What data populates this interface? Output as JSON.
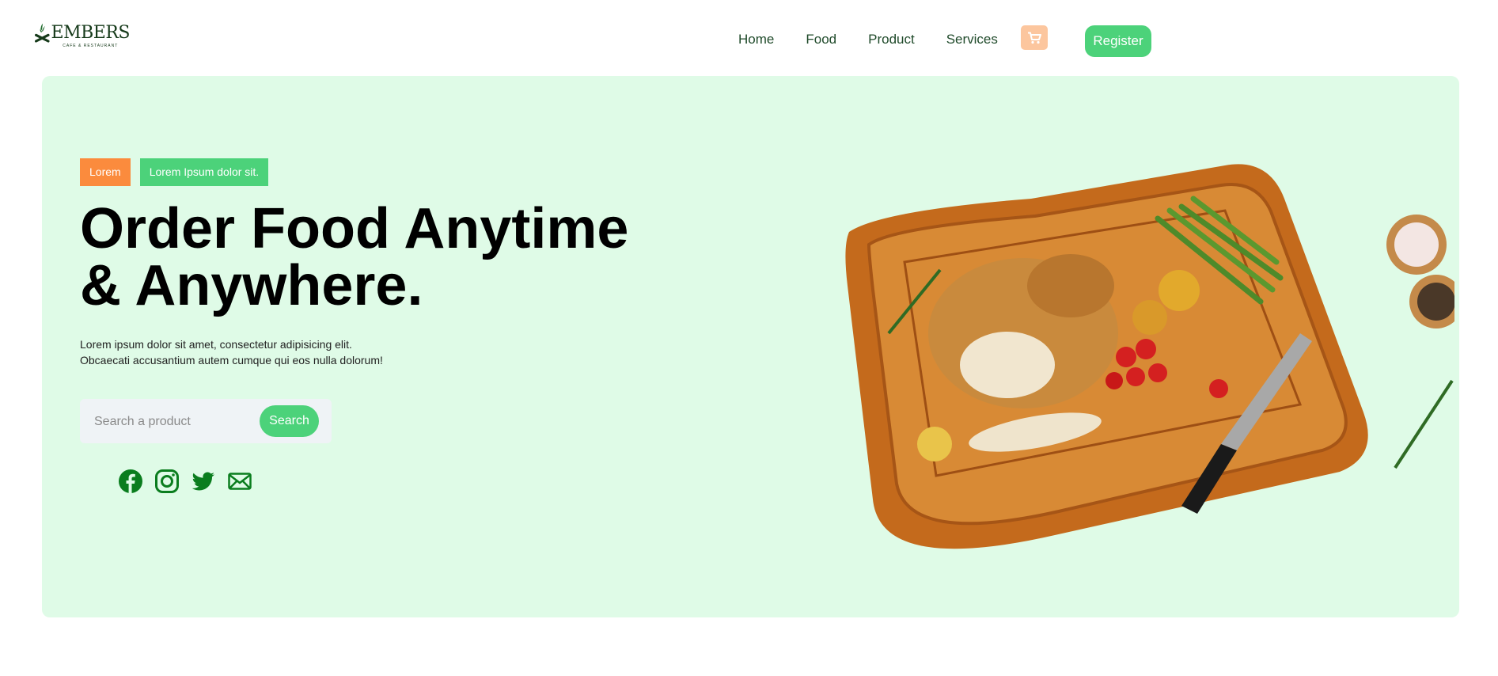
{
  "brand": {
    "name": "EMBERS",
    "tagline": "CAFE & RESTAURANT"
  },
  "nav": {
    "items": [
      "Home",
      "Food",
      "Product",
      "Services"
    ]
  },
  "header": {
    "register_label": "Register",
    "cart_icon": "cart-icon"
  },
  "hero": {
    "badge_primary": "Lorem",
    "badge_secondary": "Lorem Ipsum dolor sit.",
    "title_line1": "Order Food Anytime",
    "title_line2": "& Anywhere.",
    "description_line1": "Lorem ipsum dolor sit amet, consectetur adipisicing elit.",
    "description_line2": "Obcaecati accusantium autem cumque qui eos nulla dolorum!"
  },
  "search": {
    "placeholder": "Search a product",
    "button_label": "Search"
  },
  "social": {
    "icons": [
      "facebook-icon",
      "instagram-icon",
      "twitter-icon",
      "mail-icon"
    ]
  },
  "colors": {
    "accent_green": "#4cd27a",
    "accent_orange": "#fb8b3d",
    "hero_background": "#dffbe7",
    "cart_background": "#fcc69e",
    "social_green": "#0a7d1e"
  }
}
